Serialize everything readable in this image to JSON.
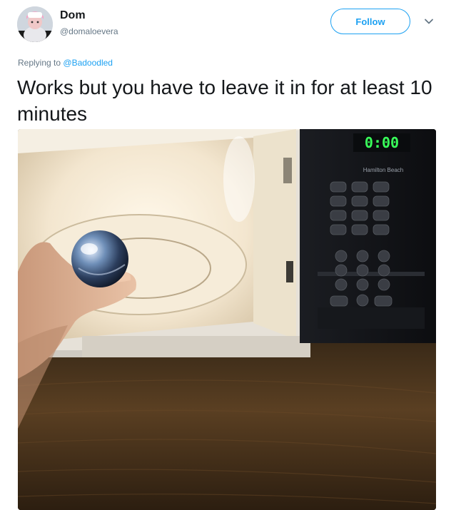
{
  "author": {
    "name": "Dom",
    "handle": "@domaloevera",
    "avatar_icon": "profile-avatar"
  },
  "actions": {
    "follow_label": "Follow",
    "more_icon": "chevron-down-icon"
  },
  "reply": {
    "prefix": "Replying to",
    "mention": "@Badoodled"
  },
  "tweet": {
    "text": "Works but you have to leave it in for at least 10 minutes"
  },
  "media": {
    "microwave_display": "0:00",
    "microwave_brand": "Hamilton Beach"
  },
  "colors": {
    "accent": "#1da1f2",
    "text_primary": "#14171a",
    "text_secondary": "#657786",
    "display_green": "#39ff5a"
  }
}
